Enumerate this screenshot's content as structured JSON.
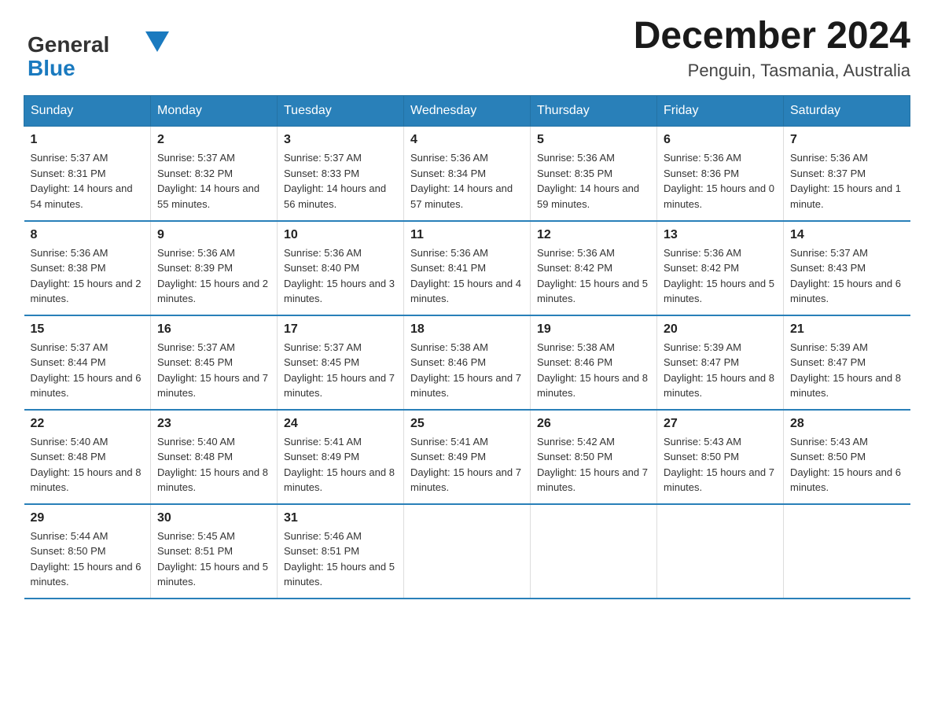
{
  "logo": {
    "general": "General",
    "blue": "Blue"
  },
  "title": "December 2024",
  "location": "Penguin, Tasmania, Australia",
  "days_of_week": [
    "Sunday",
    "Monday",
    "Tuesday",
    "Wednesday",
    "Thursday",
    "Friday",
    "Saturday"
  ],
  "weeks": [
    [
      {
        "day": "1",
        "sunrise": "5:37 AM",
        "sunset": "8:31 PM",
        "daylight": "14 hours and 54 minutes."
      },
      {
        "day": "2",
        "sunrise": "5:37 AM",
        "sunset": "8:32 PM",
        "daylight": "14 hours and 55 minutes."
      },
      {
        "day": "3",
        "sunrise": "5:37 AM",
        "sunset": "8:33 PM",
        "daylight": "14 hours and 56 minutes."
      },
      {
        "day": "4",
        "sunrise": "5:36 AM",
        "sunset": "8:34 PM",
        "daylight": "14 hours and 57 minutes."
      },
      {
        "day": "5",
        "sunrise": "5:36 AM",
        "sunset": "8:35 PM",
        "daylight": "14 hours and 59 minutes."
      },
      {
        "day": "6",
        "sunrise": "5:36 AM",
        "sunset": "8:36 PM",
        "daylight": "15 hours and 0 minutes."
      },
      {
        "day": "7",
        "sunrise": "5:36 AM",
        "sunset": "8:37 PM",
        "daylight": "15 hours and 1 minute."
      }
    ],
    [
      {
        "day": "8",
        "sunrise": "5:36 AM",
        "sunset": "8:38 PM",
        "daylight": "15 hours and 2 minutes."
      },
      {
        "day": "9",
        "sunrise": "5:36 AM",
        "sunset": "8:39 PM",
        "daylight": "15 hours and 2 minutes."
      },
      {
        "day": "10",
        "sunrise": "5:36 AM",
        "sunset": "8:40 PM",
        "daylight": "15 hours and 3 minutes."
      },
      {
        "day": "11",
        "sunrise": "5:36 AM",
        "sunset": "8:41 PM",
        "daylight": "15 hours and 4 minutes."
      },
      {
        "day": "12",
        "sunrise": "5:36 AM",
        "sunset": "8:42 PM",
        "daylight": "15 hours and 5 minutes."
      },
      {
        "day": "13",
        "sunrise": "5:36 AM",
        "sunset": "8:42 PM",
        "daylight": "15 hours and 5 minutes."
      },
      {
        "day": "14",
        "sunrise": "5:37 AM",
        "sunset": "8:43 PM",
        "daylight": "15 hours and 6 minutes."
      }
    ],
    [
      {
        "day": "15",
        "sunrise": "5:37 AM",
        "sunset": "8:44 PM",
        "daylight": "15 hours and 6 minutes."
      },
      {
        "day": "16",
        "sunrise": "5:37 AM",
        "sunset": "8:45 PM",
        "daylight": "15 hours and 7 minutes."
      },
      {
        "day": "17",
        "sunrise": "5:37 AM",
        "sunset": "8:45 PM",
        "daylight": "15 hours and 7 minutes."
      },
      {
        "day": "18",
        "sunrise": "5:38 AM",
        "sunset": "8:46 PM",
        "daylight": "15 hours and 7 minutes."
      },
      {
        "day": "19",
        "sunrise": "5:38 AM",
        "sunset": "8:46 PM",
        "daylight": "15 hours and 8 minutes."
      },
      {
        "day": "20",
        "sunrise": "5:39 AM",
        "sunset": "8:47 PM",
        "daylight": "15 hours and 8 minutes."
      },
      {
        "day": "21",
        "sunrise": "5:39 AM",
        "sunset": "8:47 PM",
        "daylight": "15 hours and 8 minutes."
      }
    ],
    [
      {
        "day": "22",
        "sunrise": "5:40 AM",
        "sunset": "8:48 PM",
        "daylight": "15 hours and 8 minutes."
      },
      {
        "day": "23",
        "sunrise": "5:40 AM",
        "sunset": "8:48 PM",
        "daylight": "15 hours and 8 minutes."
      },
      {
        "day": "24",
        "sunrise": "5:41 AM",
        "sunset": "8:49 PM",
        "daylight": "15 hours and 8 minutes."
      },
      {
        "day": "25",
        "sunrise": "5:41 AM",
        "sunset": "8:49 PM",
        "daylight": "15 hours and 7 minutes."
      },
      {
        "day": "26",
        "sunrise": "5:42 AM",
        "sunset": "8:50 PM",
        "daylight": "15 hours and 7 minutes."
      },
      {
        "day": "27",
        "sunrise": "5:43 AM",
        "sunset": "8:50 PM",
        "daylight": "15 hours and 7 minutes."
      },
      {
        "day": "28",
        "sunrise": "5:43 AM",
        "sunset": "8:50 PM",
        "daylight": "15 hours and 6 minutes."
      }
    ],
    [
      {
        "day": "29",
        "sunrise": "5:44 AM",
        "sunset": "8:50 PM",
        "daylight": "15 hours and 6 minutes."
      },
      {
        "day": "30",
        "sunrise": "5:45 AM",
        "sunset": "8:51 PM",
        "daylight": "15 hours and 5 minutes."
      },
      {
        "day": "31",
        "sunrise": "5:46 AM",
        "sunset": "8:51 PM",
        "daylight": "15 hours and 5 minutes."
      },
      null,
      null,
      null,
      null
    ]
  ],
  "labels": {
    "sunrise": "Sunrise:",
    "sunset": "Sunset:",
    "daylight": "Daylight:"
  }
}
